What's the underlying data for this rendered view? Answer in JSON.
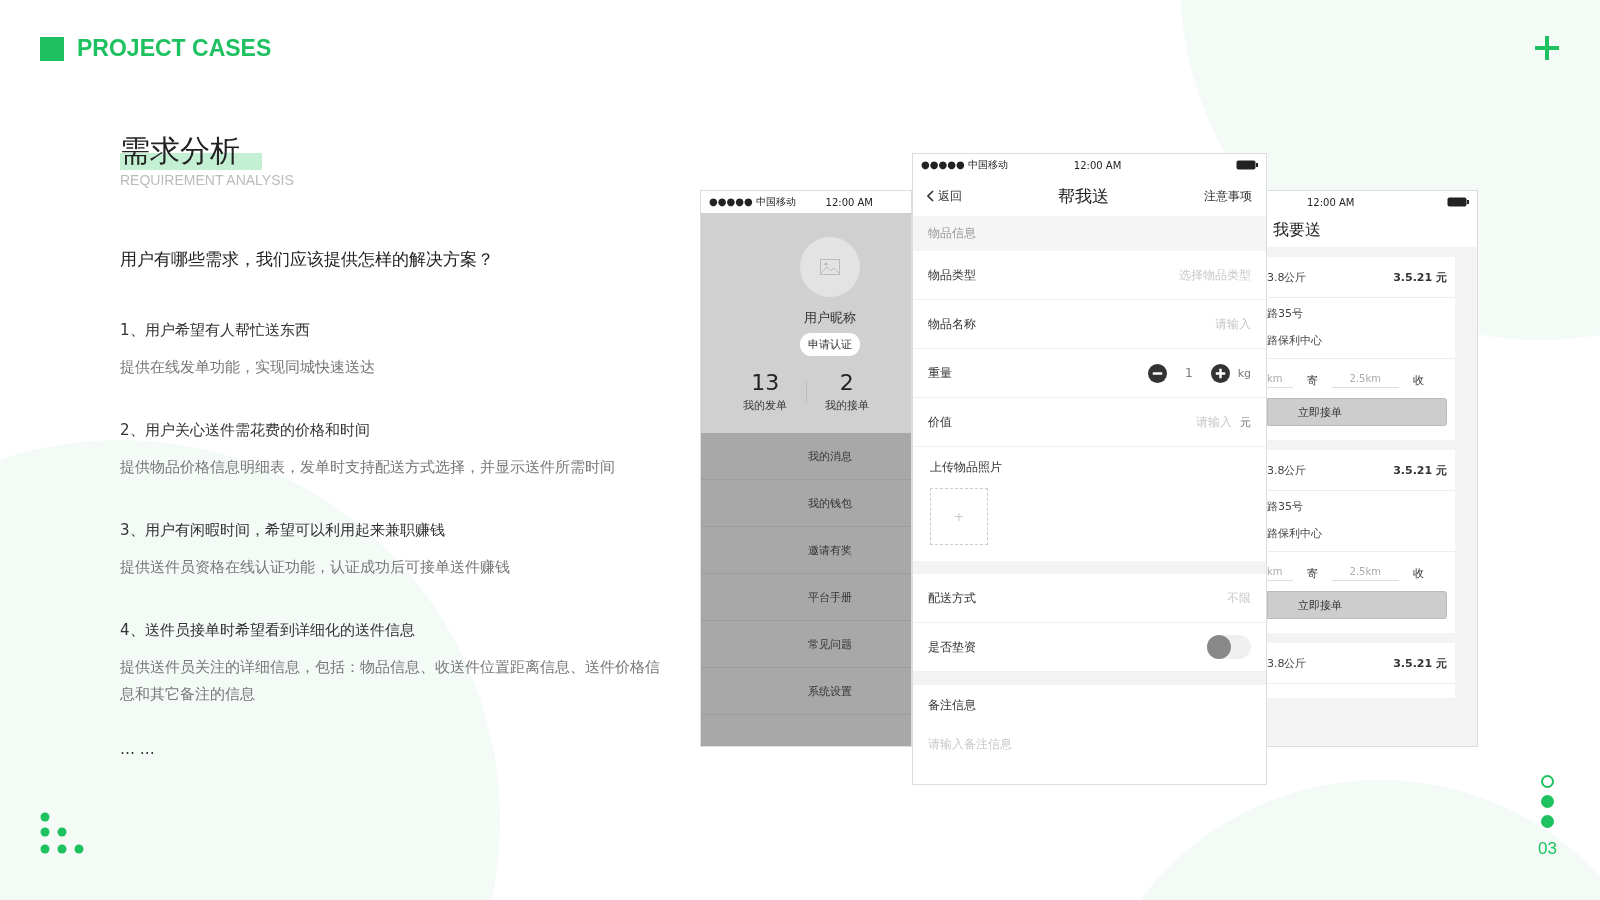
{
  "header": {
    "title": "PROJECT CASES"
  },
  "section": {
    "title": "需求分析",
    "subtitle": "REQUIREMENT ANALYSIS",
    "question": "用户有哪些需求，我们应该提供怎样的解决方案？",
    "items": [
      {
        "heading": "1、用户希望有人帮忙送东西",
        "body": "提供在线发单功能，实现同城快速送达"
      },
      {
        "heading": "2、用户关心送件需花费的价格和时间",
        "body": "提供物品价格信息明细表，发单时支持配送方式选择，并显示送件所需时间"
      },
      {
        "heading": "3、用户有闲暇时间，希望可以利用起来兼职赚钱",
        "body": "提供送件员资格在线认证功能，认证成功后可接单送件赚钱"
      },
      {
        "heading": "4、送件员接单时希望看到详细化的送件信息",
        "body": "提供送件员关注的详细信息，包括：物品信息、收送件位置距离信息、送件价格信息和其它备注的信息"
      }
    ],
    "ellipsis": "… …"
  },
  "profile_screen": {
    "signal": "●●●●●",
    "carrier": "中国移动",
    "time": "12:00 AM",
    "nickname": "用户昵称",
    "verify_button": "申请认证",
    "stats": [
      {
        "value": "13",
        "label": "我的发单"
      },
      {
        "value": "2",
        "label": "我的接单"
      }
    ],
    "menu": [
      "我的消息",
      "我的钱包",
      "邀请有奖",
      "平台手册",
      "常见问题",
      "系统设置"
    ]
  },
  "send_form_screen": {
    "signal": "●●●●●",
    "carrier": "中国移动",
    "time": "12:00 AM",
    "back": "返回",
    "title": "帮我送",
    "notice": "注意事项",
    "section_header": "物品信息",
    "rows": [
      {
        "kind": "select",
        "label": "物品类型",
        "placeholder": "选择物品类型"
      },
      {
        "kind": "input",
        "label": "物品名称",
        "placeholder": "请输入"
      },
      {
        "kind": "stepper",
        "label": "重量",
        "value": "1",
        "unit": "kg"
      },
      {
        "kind": "input",
        "label": "价值",
        "placeholder": "请输入",
        "unit": "元"
      }
    ],
    "upload_label": "上传物品照片",
    "upload_plus": "+",
    "options": [
      {
        "kind": "select",
        "label": "配送方式",
        "placeholder": "不限"
      },
      {
        "kind": "toggle",
        "label": "是否垫资",
        "on": false
      }
    ],
    "note_label": "备注信息",
    "note_placeholder": "请输入备注信息"
  },
  "orders_screen": {
    "time": "12:00 AM",
    "title": "我要送",
    "orders": [
      {
        "weight": "3.8公斤",
        "price": "3.5.21 元",
        "from": "路35号",
        "to": "路保利中心",
        "distance_1": "km",
        "tag_1": "寄",
        "distance_2": "2.5km",
        "tag_2": "收",
        "button": "立即接单"
      },
      {
        "weight": "3.8公斤",
        "price": "3.5.21 元",
        "from": "路35号",
        "to": "路保利中心",
        "distance_1": "km",
        "tag_1": "寄",
        "distance_2": "2.5km",
        "tag_2": "收",
        "button": "立即接单"
      },
      {
        "weight": "3.8公斤",
        "price": "3.5.21 元"
      }
    ]
  },
  "page_dots": [
    {
      "selected": true
    },
    {
      "selected": false
    },
    {
      "selected": false
    }
  ],
  "page_number": "03"
}
